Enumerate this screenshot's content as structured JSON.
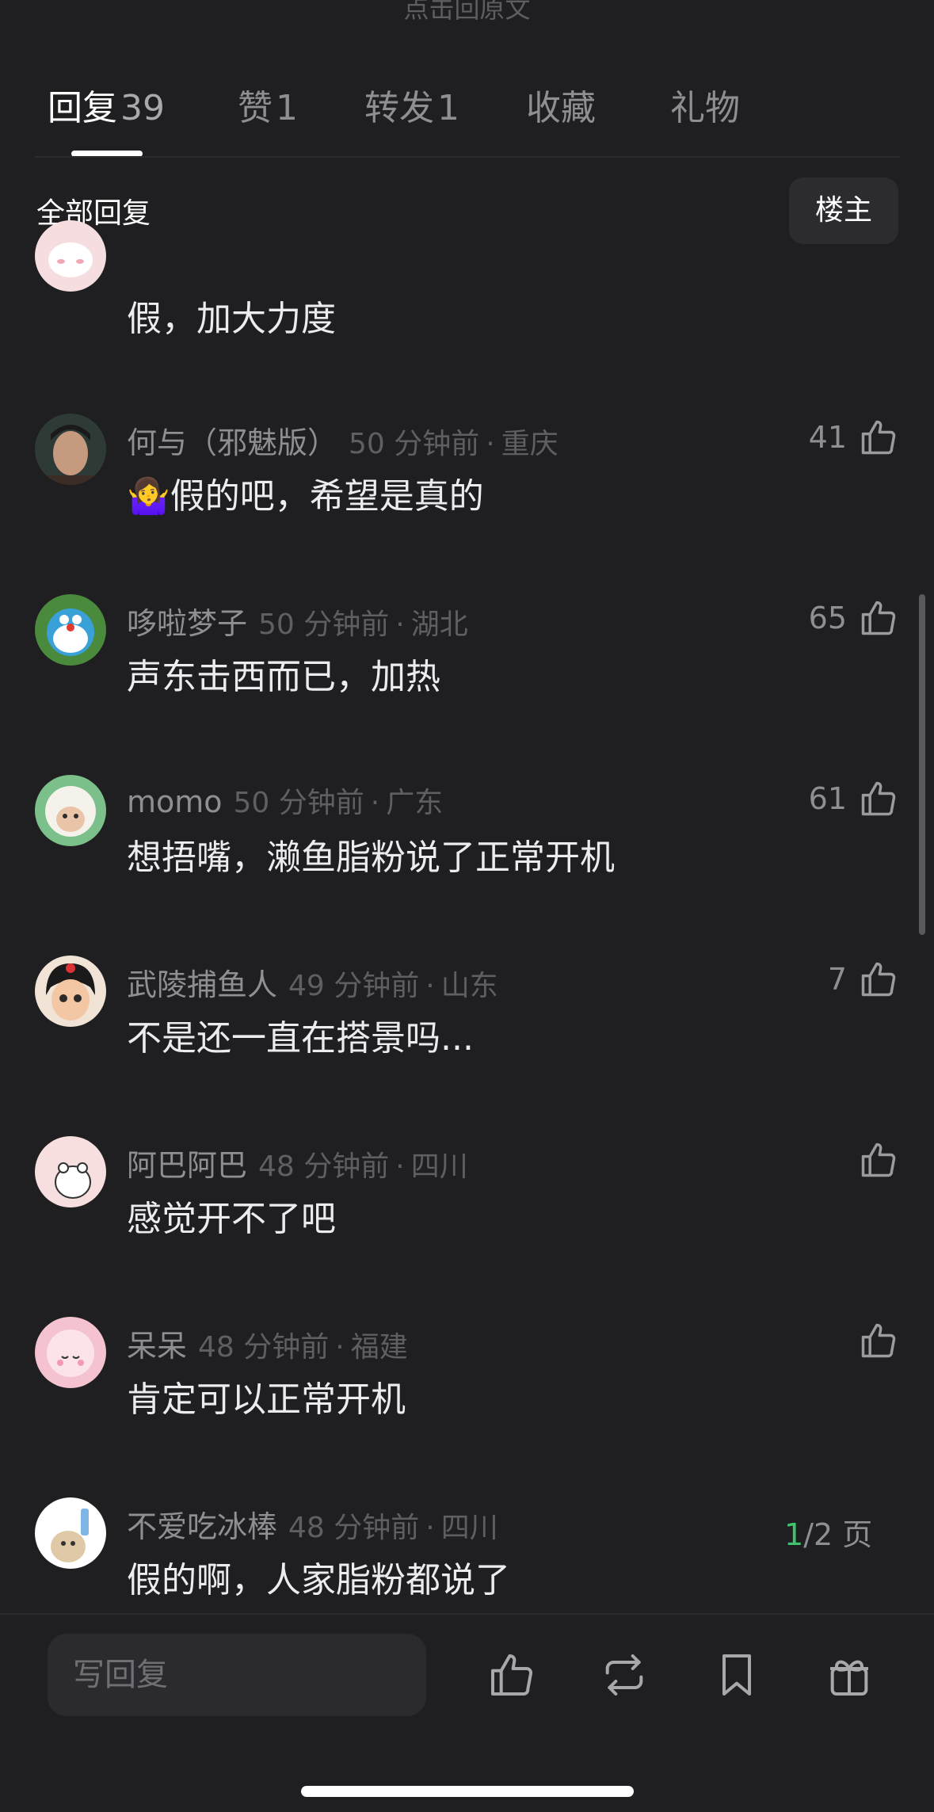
{
  "top_hint": "点击回原文",
  "tabs": [
    {
      "label": "回复",
      "count": "39"
    },
    {
      "label": "赞",
      "count": "1"
    },
    {
      "label": "转发",
      "count": "1"
    },
    {
      "label": "收藏",
      "count": ""
    },
    {
      "label": "礼物",
      "count": ""
    }
  ],
  "filter": {
    "title": "全部回复",
    "op_button": "楼主"
  },
  "comments": [
    {
      "name": "",
      "time": "",
      "location": "",
      "text": "假，加大力度",
      "likes": ""
    },
    {
      "name": "何与（邪魅版）",
      "time": "50 分钟前",
      "location": "重庆",
      "text": "🤷‍♀️假的吧，希望是真的",
      "likes": "41"
    },
    {
      "name": "哆啦梦子",
      "time": "50 分钟前",
      "location": "湖北",
      "text": "声东击西而已，加热",
      "likes": "65"
    },
    {
      "name": "momo",
      "time": "50 分钟前",
      "location": "广东",
      "text": "想捂嘴，濑鱼脂粉说了正常开机",
      "likes": "61"
    },
    {
      "name": "武陵捕鱼人",
      "time": "49 分钟前",
      "location": "山东",
      "text": "不是还一直在搭景吗...",
      "likes": "7"
    },
    {
      "name": "阿巴阿巴",
      "time": "48 分钟前",
      "location": "四川",
      "text": "感觉开不了吧",
      "likes": ""
    },
    {
      "name": "呆呆",
      "time": "48 分钟前",
      "location": "福建",
      "text": "肯定可以正常开机",
      "likes": ""
    },
    {
      "name": "不爱吃冰棒",
      "time": "48 分钟前",
      "location": "四川",
      "text": "假的啊，人家脂粉都说了",
      "likes": ""
    }
  ],
  "pager": {
    "current": "1",
    "total": "/2 页"
  },
  "bottom_bar": {
    "reply_placeholder": "写回复"
  },
  "colors": {
    "background": "#1f1f22",
    "accent_green": "#3ec46d",
    "text_primary": "#ececef",
    "text_secondary": "#8e8e93"
  },
  "icons": [
    "thumbs-up-icon",
    "repost-icon",
    "bookmark-icon",
    "gift-icon"
  ]
}
